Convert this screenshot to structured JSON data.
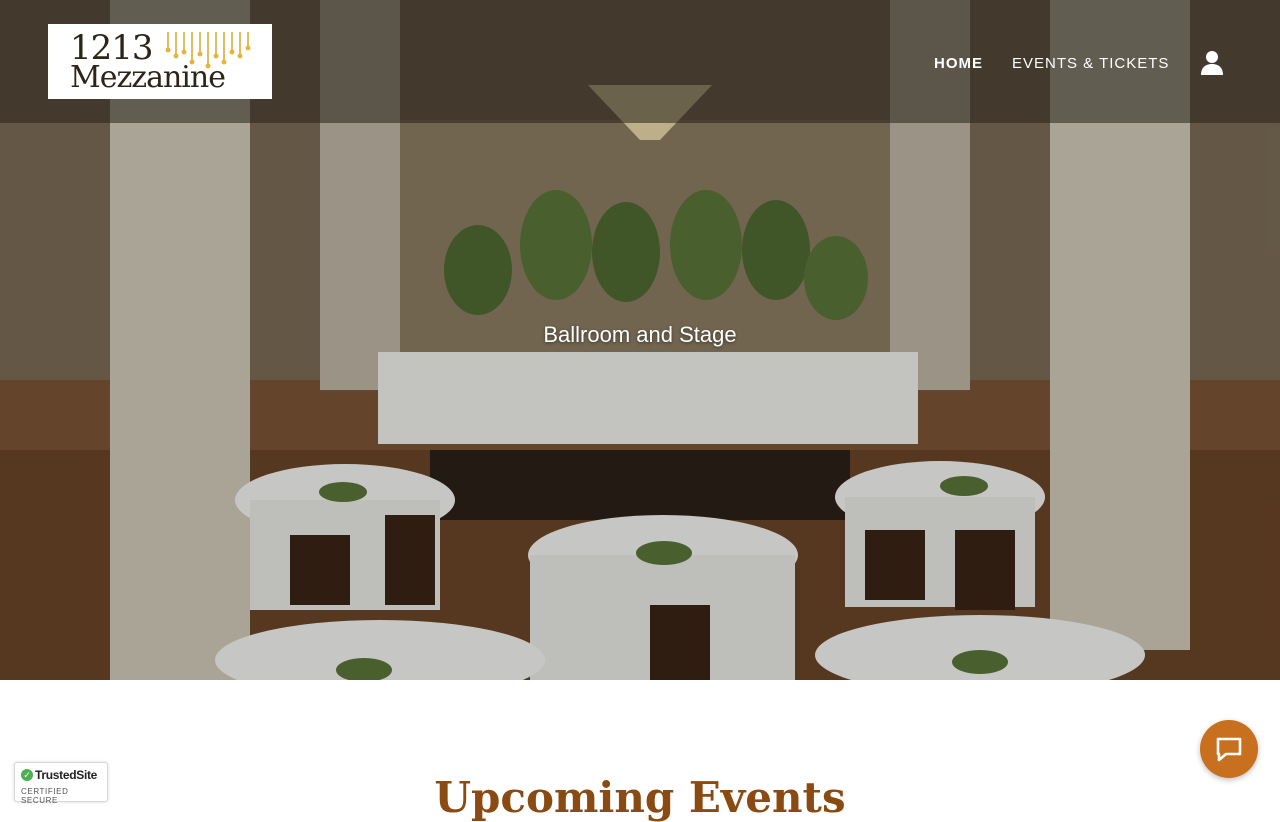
{
  "header": {
    "logo": {
      "number": "1213",
      "name": "Mezzanine"
    },
    "nav": [
      {
        "label": "HOME",
        "active": true
      },
      {
        "label": "EVENTS & TICKETS",
        "active": false
      }
    ],
    "account_icon": "user-icon"
  },
  "hero": {
    "caption": "Ballroom and Stage"
  },
  "main": {
    "section_title": "Upcoming Events"
  },
  "badge": {
    "name": "TrustedSite",
    "subtitle": "CERTIFIED SECURE"
  },
  "chat": {
    "icon": "chat-bubble-icon"
  },
  "colors": {
    "accent": "#c8701e",
    "title": "#8a4b12",
    "header_overlay": "rgba(40,34,26,0.55)"
  }
}
